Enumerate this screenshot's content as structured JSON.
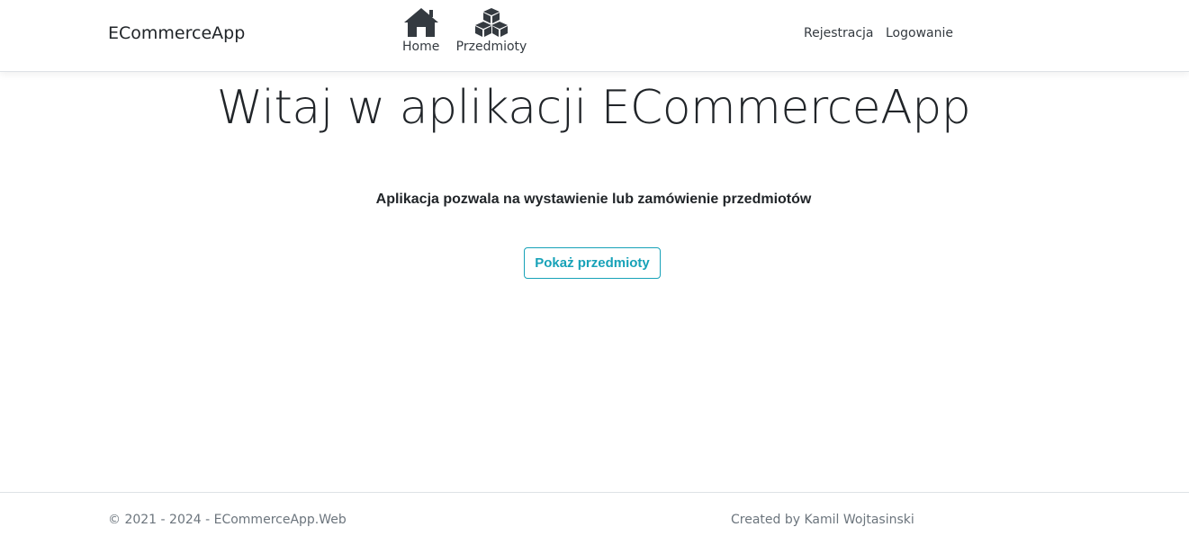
{
  "navbar": {
    "brand": "ECommerceApp",
    "links": [
      {
        "label": "Home",
        "icon": "home-icon"
      },
      {
        "label": "Przedmioty",
        "icon": "cubes-icon"
      }
    ],
    "register_label": "Rejestracja",
    "login_label": "Logowanie"
  },
  "main": {
    "title": "Witaj w aplikacji ECommerceApp",
    "description": "Aplikacja pozwala na wystawienie lub zamówienie przedmiotów",
    "show_items_button": "Pokaż przedmioty"
  },
  "footer": {
    "copyright": "© 2021 - 2024 - ECommerceApp.Web",
    "author": "Created by Kamil Wojtasinski"
  },
  "colors": {
    "accent": "#17a2b8",
    "text": "#212529",
    "muted": "#6c757d",
    "icon": "#343a40"
  }
}
